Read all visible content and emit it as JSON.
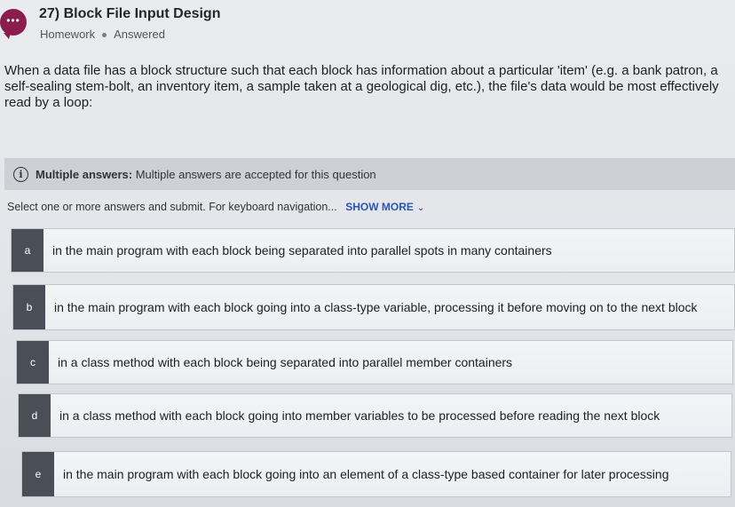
{
  "header": {
    "chat_icon_label": "•••",
    "title": "27) Block File Input Design",
    "type": "Homework",
    "status": "Answered"
  },
  "question": {
    "text": "When a data file has a block structure such that each block has information about a particular 'item' (e.g. a bank patron, a self-sealing stem-bolt, an inventory item, a sample taken at a geological dig, etc.), the file's data would be most effectively read by a loop:"
  },
  "info": {
    "icon": "info-icon",
    "label": "Multiple answers:",
    "text": " Multiple answers are accepted for this question"
  },
  "instructions": {
    "text": "Select one or more answers and submit. For keyboard navigation...",
    "show_more": "SHOW MORE"
  },
  "options": [
    {
      "letter": "a",
      "text": "in the main program with each block being separated into parallel spots in many containers"
    },
    {
      "letter": "b",
      "text": "in the main program with each block going into a class-type variable, processing it before moving on to the next block"
    },
    {
      "letter": "c",
      "text": "in a class method with each block being separated into parallel member containers"
    },
    {
      "letter": "d",
      "text": "in a class method with each block going into member variables to be processed before reading the next block"
    },
    {
      "letter": "e",
      "text": "in the main program with each block going into an element of a class-type based container for later processing"
    }
  ]
}
